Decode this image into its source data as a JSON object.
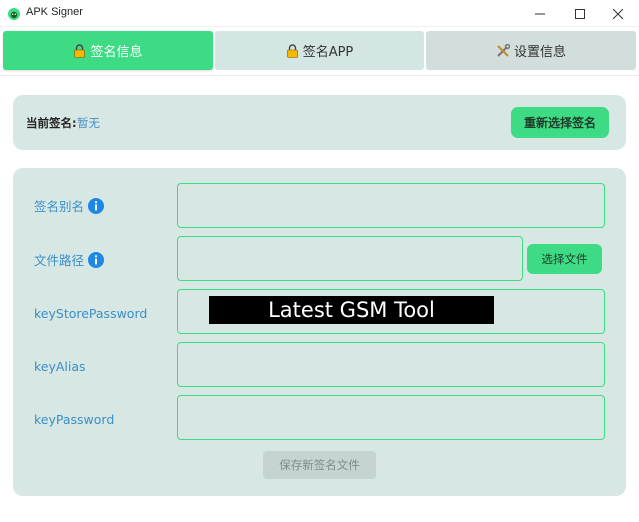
{
  "window": {
    "title": "APK Signer",
    "icons": {
      "app": "android-icon",
      "minimize": "minimize-icon",
      "maximize": "maximize-icon",
      "close": "close-icon"
    }
  },
  "tabs": [
    {
      "label": "签名信息",
      "icon": "lock-icon",
      "active": true
    },
    {
      "label": "签名APP",
      "icon": "lock-icon",
      "active": false
    },
    {
      "label": "设置信息",
      "icon": "tools-icon",
      "active": false
    }
  ],
  "current_signature": {
    "label": "当前签名:",
    "value": "暂无",
    "reselect_button": "重新选择签名"
  },
  "form": {
    "alias_label": "签名别名",
    "path_label": "文件路径",
    "choose_file_button": "选择文件",
    "keystore_password_label": "keyStorePassword",
    "key_alias_label": "keyAlias",
    "key_password_label": "keyPassword",
    "save_button": "保存新签名文件"
  },
  "banner": {
    "text": "Latest GSM Tool"
  },
  "colors": {
    "accent": "#3ddc84",
    "panel": "#d7e7e4",
    "label_blue": "#3a8fc8",
    "info_blue": "#1e88e5"
  }
}
